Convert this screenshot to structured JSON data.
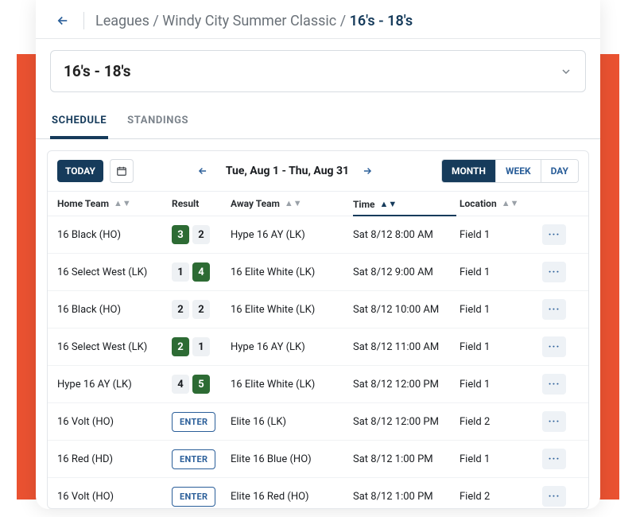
{
  "breadcrumb": {
    "root": "Leagues",
    "league": "Windy City Summer Classic",
    "division": "16's - 18's"
  },
  "division_select": {
    "label": "16's - 18's"
  },
  "tabs": {
    "schedule": "SCHEDULE",
    "standings": "STANDINGS",
    "active": "schedule"
  },
  "toolbar": {
    "today": "TODAY",
    "range": "Tue, Aug 1 - Thu, Aug 31",
    "view_month": "MONTH",
    "view_week": "WEEK",
    "view_day": "DAY",
    "active_view": "month"
  },
  "columns": {
    "home": "Home Team",
    "result": "Result",
    "away": "Away Team",
    "time": "Time",
    "location": "Location"
  },
  "enter_label": "ENTER",
  "rows": [
    {
      "home": "16 Black (HO)",
      "result": {
        "home": 3,
        "away": 2,
        "winner": "home"
      },
      "away": "Hype 16 AY (LK)",
      "time": "Sat 8/12 8:00 AM",
      "location": "Field 1"
    },
    {
      "home": "16 Select West (LK)",
      "result": {
        "home": 1,
        "away": 4,
        "winner": "away"
      },
      "away": "16 Elite White (LK)",
      "time": "Sat 8/12 9:00 AM",
      "location": "Field 1"
    },
    {
      "home": "16 Black (HO)",
      "result": {
        "home": 2,
        "away": 2,
        "winner": "none"
      },
      "away": "16 Elite White (LK)",
      "time": "Sat 8/12 10:00 AM",
      "location": "Field 1"
    },
    {
      "home": "16 Select West (LK)",
      "result": {
        "home": 2,
        "away": 1,
        "winner": "home"
      },
      "away": "Hype 16 AY (LK)",
      "time": "Sat 8/12 11:00 AM",
      "location": "Field 1"
    },
    {
      "home": "Hype 16 AY (LK)",
      "result": {
        "home": 4,
        "away": 5,
        "winner": "away"
      },
      "away": "16 Elite White (LK)",
      "time": "Sat 8/12 12:00 PM",
      "location": "Field 1"
    },
    {
      "home": "16 Volt (HO)",
      "result": null,
      "away": "Elite 16 (LK)",
      "time": "Sat 8/12 12:00 PM",
      "location": "Field 2"
    },
    {
      "home": "16 Red (HD)",
      "result": null,
      "away": "Elite 16 Blue (HO)",
      "time": "Sat 8/12 1:00 PM",
      "location": "Field 1"
    },
    {
      "home": "16 Volt (HO)",
      "result": null,
      "away": "Elite 16 Red (HO)",
      "time": "Sat 8/12 1:00 PM",
      "location": "Field 2"
    }
  ]
}
